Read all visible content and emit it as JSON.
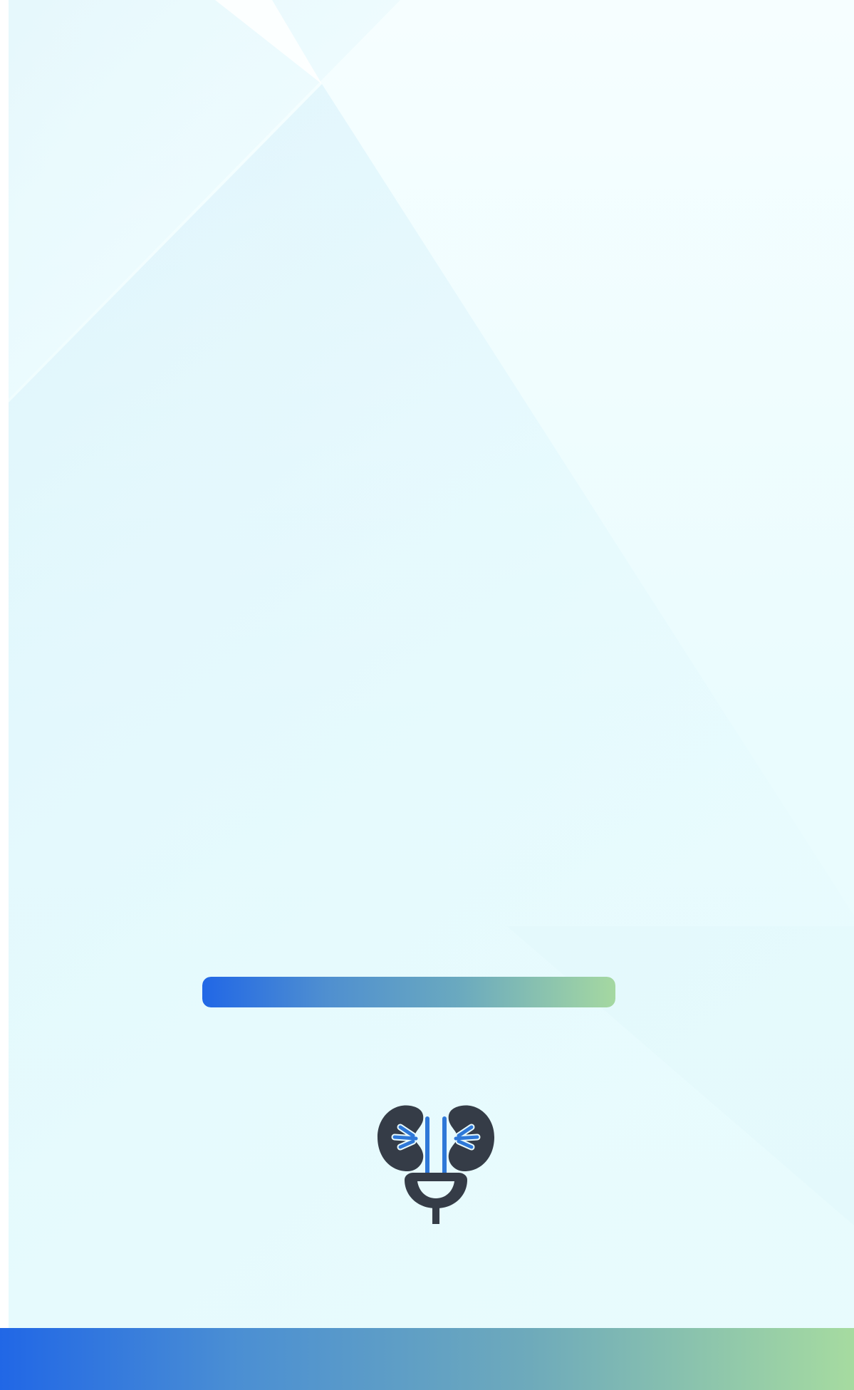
{
  "app": {
    "screen": "splash"
  },
  "loading": {
    "progress_fraction": 1.0,
    "bar_colors": [
      "#2167e6",
      "#4f8fd0",
      "#6aa9bf",
      "#a5d8a1"
    ]
  },
  "logo": {
    "icon": "kidney-bladder-icon",
    "colors": {
      "organ": "#353c47",
      "vessel": "#2e78d8"
    }
  },
  "theme": {
    "background": "#eafcfe",
    "accent": "#2167e6",
    "accent_secondary": "#a6dba0"
  }
}
